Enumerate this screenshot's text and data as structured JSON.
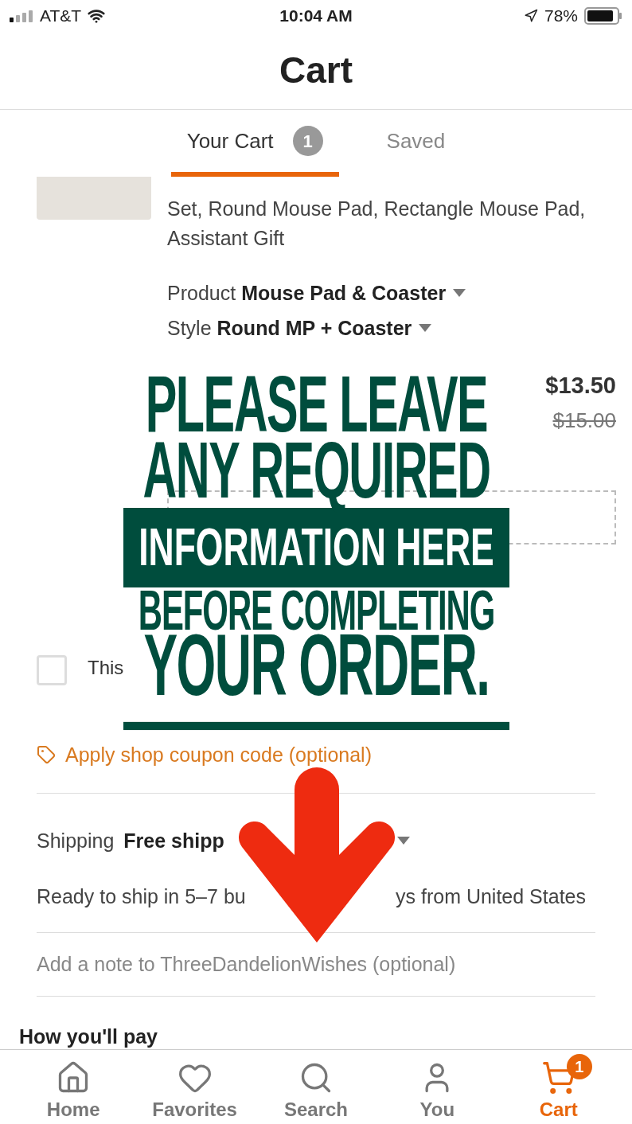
{
  "status_bar": {
    "carrier": "AT&T",
    "time": "10:04 AM",
    "battery": "78%"
  },
  "title": "Cart",
  "tabs": [
    {
      "label": "Your Cart",
      "badge": "1",
      "selected": true
    },
    {
      "label": "Saved",
      "selected": false
    }
  ],
  "item": {
    "title_tail": "Set, Round Mouse Pad, Rectangle Mouse Pad, Assistant Gift",
    "options": [
      {
        "label": "Product",
        "value": "Mouse Pad & Coaster"
      },
      {
        "label": "Style",
        "value": "Round MP + Coaster"
      }
    ],
    "price": "$13.50",
    "original_price": "$15.00"
  },
  "gift": {
    "label": "This",
    "checked": false
  },
  "coupon": "Apply shop coupon code (optional)",
  "shipping": {
    "label": "Shipping",
    "value": "Free shipp",
    "eta_start": "Ready to ship in 5–7 bu",
    "eta_end": "ys from United States"
  },
  "note": "Add a note to ThreeDandelionWishes (optional)",
  "payment_heading": "How you'll pay",
  "overlay": {
    "lines": [
      {
        "text": "PLEASE LEAVE",
        "kind": "plain"
      },
      {
        "text": "ANY REQUIRED",
        "kind": "plain"
      },
      {
        "text": "INFORMATION HERE",
        "kind": "band"
      },
      {
        "text": "BEFORE COMPLETING",
        "kind": "plain"
      },
      {
        "text": "YOUR ORDER.",
        "kind": "underlined"
      }
    ]
  },
  "nav": [
    {
      "label": "Home",
      "selected": false
    },
    {
      "label": "Favorites",
      "selected": false
    },
    {
      "label": "Search",
      "selected": false
    },
    {
      "label": "You",
      "selected": false
    },
    {
      "label": "Cart",
      "badge": "1",
      "selected": true
    }
  ]
}
